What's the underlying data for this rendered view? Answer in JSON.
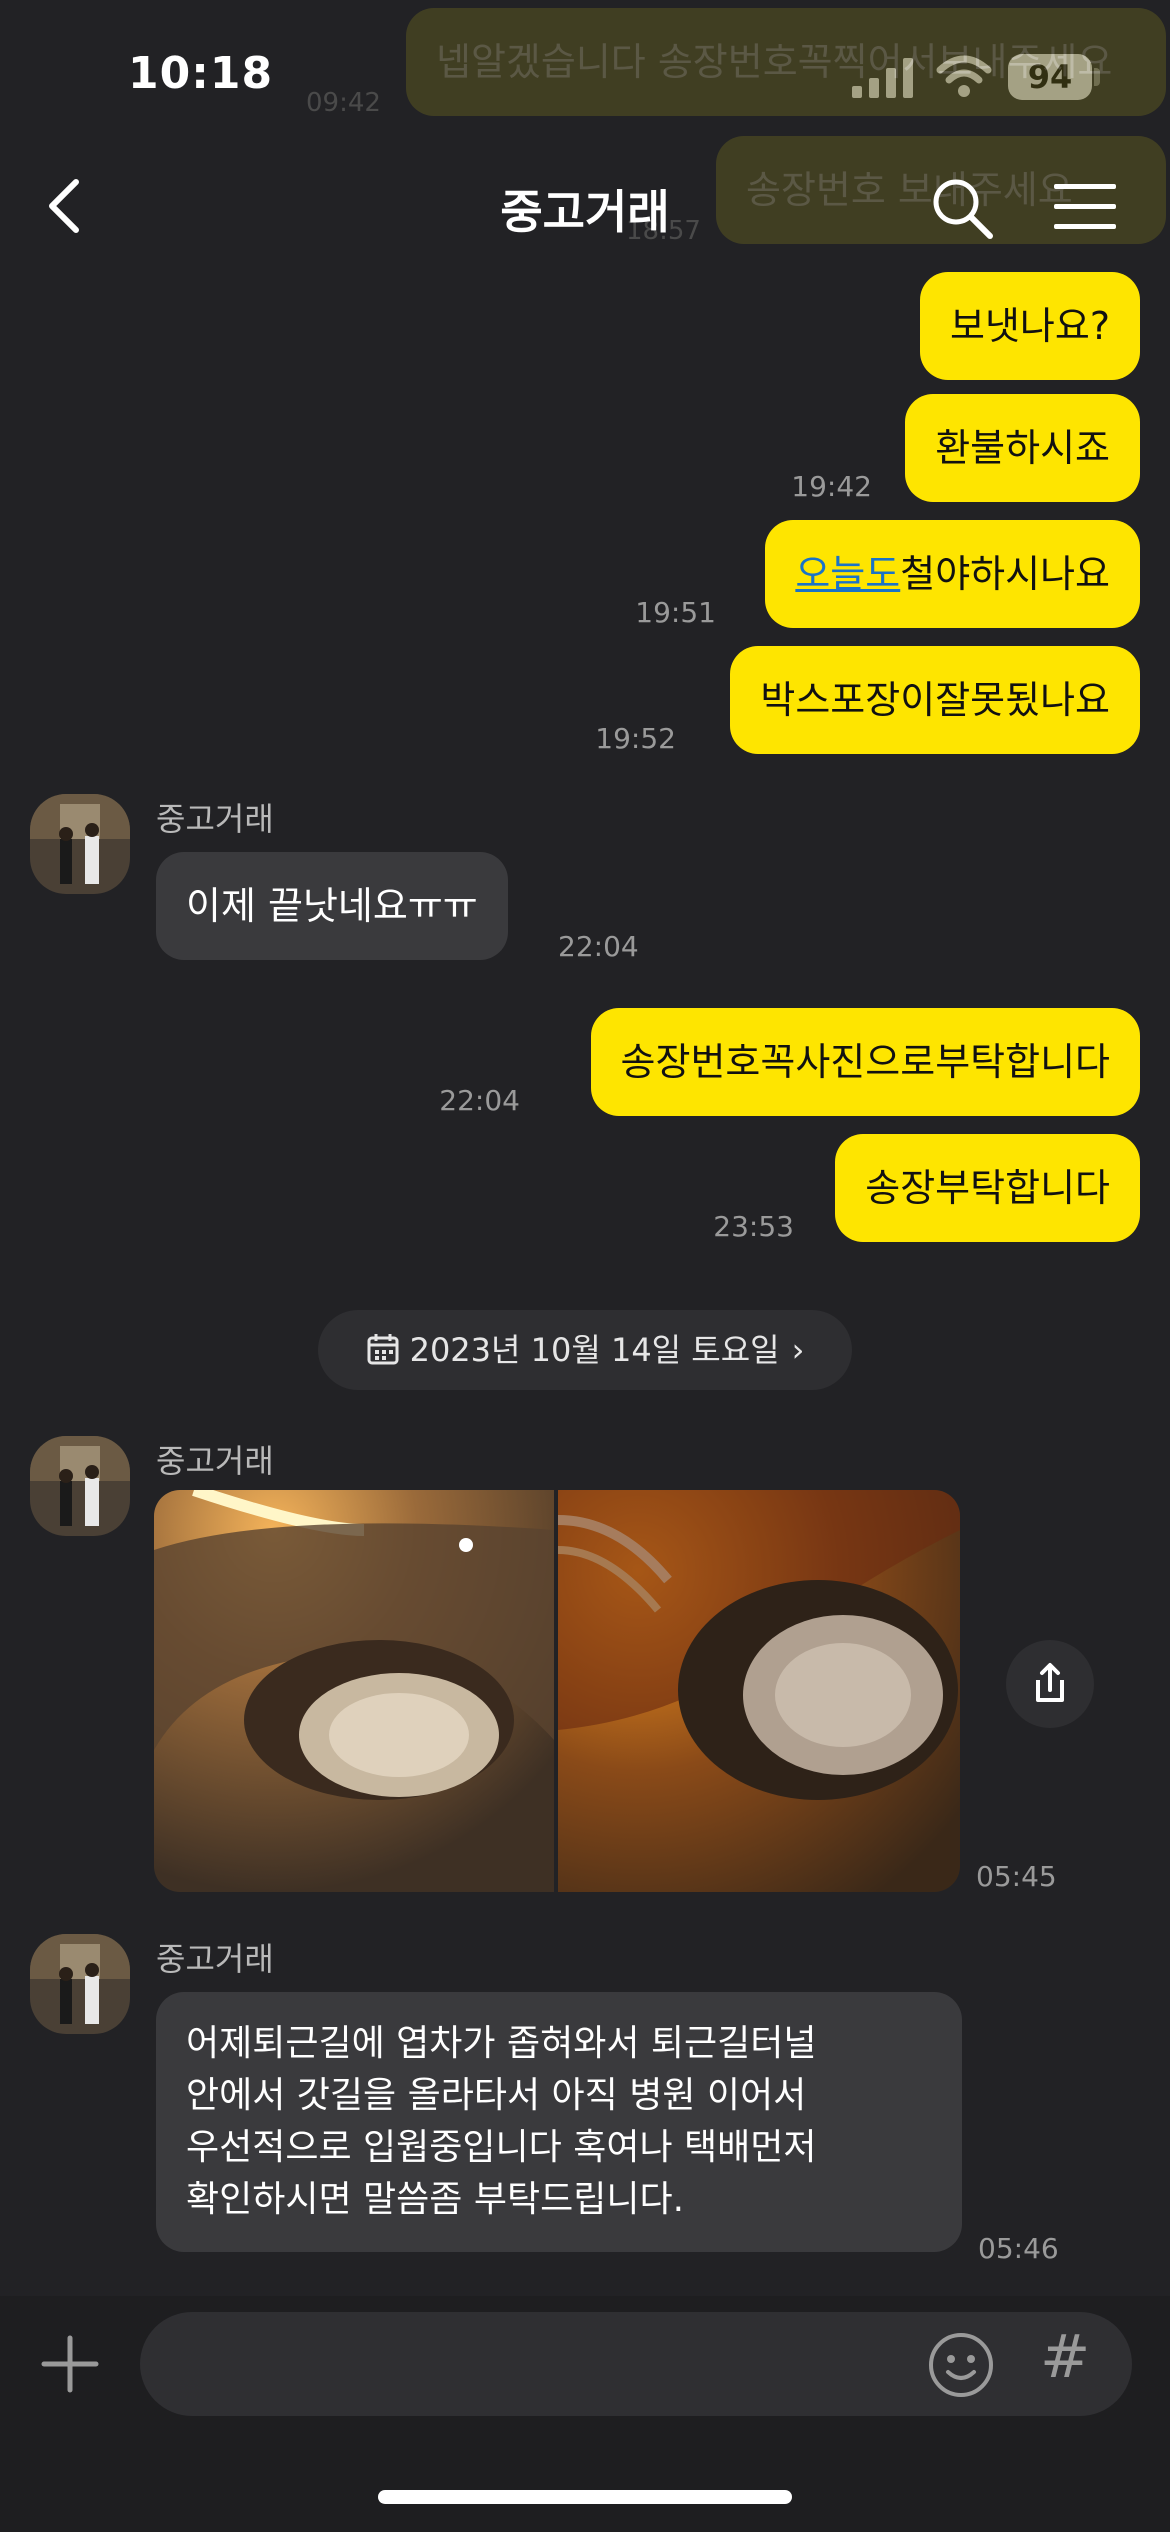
{
  "status_bar": {
    "time": "10:18",
    "battery": "94"
  },
  "header": {
    "title": "중고거래"
  },
  "ghost_messages": [
    {
      "text": "넵알겠습니다 송장번호꼭찍어서보내주세요",
      "time": "09:42"
    },
    {
      "text": "송장번호 보내주세요",
      "time": "18:57"
    }
  ],
  "messages": [
    {
      "from": "me",
      "text": "보냇나요?",
      "time": ""
    },
    {
      "from": "me",
      "text": "환불하시죠",
      "time": "19:42"
    },
    {
      "from": "me",
      "link_text": "오늘도",
      "text": "철야하시나요",
      "time": "19:51"
    },
    {
      "from": "me",
      "text": "박스포장이잘못됬나요",
      "time": "19:52"
    },
    {
      "from": "other",
      "sender": "중고거래",
      "text": "이제 끝낫네요ㅠㅠ",
      "time": "22:04"
    },
    {
      "from": "me",
      "text": "송장번호꼭사진으로부탁합니다",
      "time": "22:04"
    },
    {
      "from": "me",
      "text": "송장부탁합니다",
      "time": "23:53"
    }
  ],
  "date_divider": "2023년 10월 14일 토요일",
  "photo_message": {
    "sender": "중고거래",
    "time": "05:45"
  },
  "last_message": {
    "sender": "중고거래",
    "lines": [
      "어제퇴근길에 엽차가 좁혀와서 퇴근길터널",
      "안에서 갓길을 올라타서 아직 병원 이어서",
      "우선적으로 입웝중입니다 혹여나 택배먼저",
      "확인하시면 말씀좀 부탁드립니다."
    ],
    "time": "05:46"
  },
  "input": {
    "placeholder": ""
  },
  "icons": {
    "back": "chevron-left-icon",
    "search": "search-icon",
    "menu": "hamburger-menu-icon",
    "plus": "plus-icon",
    "emoji": "smiley-icon",
    "hash": "hashtag-icon",
    "share": "share-icon",
    "calendar": "calendar-icon"
  },
  "colors": {
    "my_bubble": "#fee500",
    "other_bubble": "#3a3a3d",
    "background": "#222225",
    "link": "#1a73c8"
  }
}
